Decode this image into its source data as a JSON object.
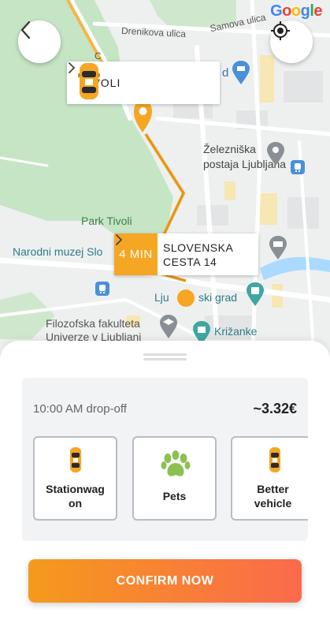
{
  "map": {
    "google_logo": [
      "G",
      "o",
      "o",
      "g",
      "l",
      "e"
    ],
    "google_colors": [
      "#4285F4",
      "#EA4335",
      "#FBBC05",
      "#4285F4",
      "#34A853",
      "#EA4335"
    ],
    "labels": {
      "drenikova": "Drenikova ulica",
      "samova": "Samova ulica",
      "c_letter": "C",
      "zelezniska_1": "Železniška",
      "zelezniska_2": "postaja Ljubljana",
      "park_tivoli": "Park Tivoli",
      "narodni_muzej": "Narodni muzej Slo",
      "ljubljanski_grad_left": "Lju",
      "ljubljanski_grad_right": "ski grad",
      "filozofska_1": "Filozofska fakulteta",
      "filozofska_2": "Univerze v Ljubljani",
      "krizanke": "Križanke",
      "d_letter": "d"
    },
    "colors": {
      "route": "#f5a623",
      "park": "#c8e6c9",
      "water": "#aadaff",
      "poi_blue": "#4a90d9",
      "poi_teal": "#3fa7a0"
    }
  },
  "back_button": {
    "icon": "chevron-left-icon"
  },
  "locate_button": {
    "icon": "crosshair-icon"
  },
  "origin": {
    "label": "TIVOLI",
    "icon": "taxi-icon"
  },
  "destination": {
    "eta": "4 MIN",
    "address_line1": "SLOVENSKA",
    "address_line2": "CESTA 14"
  },
  "ride": {
    "dropoff": "10:00 AM drop-off",
    "price": "~3.32€",
    "options": [
      {
        "line1": "Stationwag",
        "line2": "on",
        "icon": "taxi-icon"
      },
      {
        "line1": "Pets",
        "line2": "",
        "icon": "paw-icon"
      },
      {
        "line1": "Better",
        "line2": "vehicle",
        "icon": "taxi-icon"
      }
    ]
  },
  "confirm_label": "CONFIRM NOW"
}
